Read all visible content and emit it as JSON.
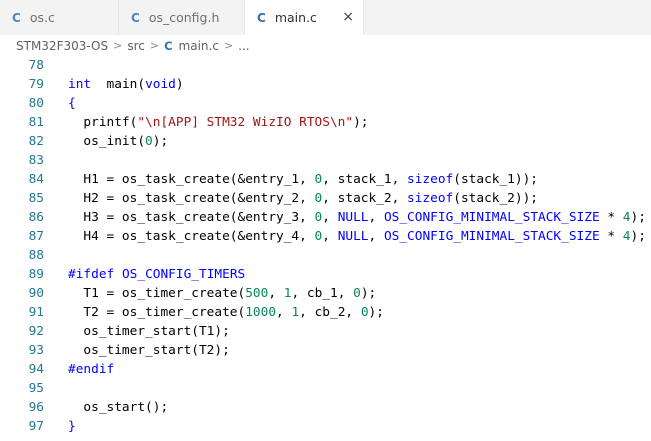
{
  "tabs": [
    {
      "icon": "C",
      "label": "os.c"
    },
    {
      "icon": "C",
      "label": "os_config.h"
    },
    {
      "icon": "C",
      "label": "main.c",
      "close": "×"
    }
  ],
  "breadcrumb": {
    "project": "STM32F303-OS",
    "folder": "src",
    "file_icon": "C",
    "file": "main.c",
    "more": "...",
    "separator": ">"
  },
  "colors": {
    "keyword": "#0000ff",
    "string": "#a31515",
    "number": "#098658",
    "line_number": "#237893",
    "c_icon": "#2f6fb3"
  },
  "code_lines": [
    {
      "n": "78",
      "tokens": []
    },
    {
      "n": "79",
      "tokens": [
        [
          "kw",
          "int"
        ],
        [
          "",
          "  main("
        ],
        [
          "kw",
          "void"
        ],
        [
          "",
          ")"
        ]
      ]
    },
    {
      "n": "80",
      "tokens": [
        [
          "kw",
          "{"
        ]
      ]
    },
    {
      "n": "81",
      "tokens": [
        [
          "",
          "  printf("
        ],
        [
          "str",
          "\"\\n[APP] STM32 WizIO RTOS\\n\""
        ],
        [
          "",
          ");"
        ]
      ]
    },
    {
      "n": "82",
      "tokens": [
        [
          "",
          "  os_init("
        ],
        [
          "num",
          "0"
        ],
        [
          "",
          ");"
        ]
      ]
    },
    {
      "n": "83",
      "tokens": []
    },
    {
      "n": "84",
      "tokens": [
        [
          "",
          "  H1 = os_task_create(&entry_1, "
        ],
        [
          "num",
          "0"
        ],
        [
          "",
          ", stack_1, "
        ],
        [
          "kw",
          "sizeof"
        ],
        [
          "",
          "(stack_1));"
        ]
      ]
    },
    {
      "n": "85",
      "tokens": [
        [
          "",
          "  H2 = os_task_create(&entry_2, "
        ],
        [
          "num",
          "0"
        ],
        [
          "",
          ", stack_2, "
        ],
        [
          "kw",
          "sizeof"
        ],
        [
          "",
          "(stack_2));"
        ]
      ]
    },
    {
      "n": "86",
      "tokens": [
        [
          "",
          "  H3 = os_task_create(&entry_3, "
        ],
        [
          "num",
          "0"
        ],
        [
          "",
          ", "
        ],
        [
          "mac",
          "NULL"
        ],
        [
          "",
          ", "
        ],
        [
          "mac",
          "OS_CONFIG_MINIMAL_STACK_SIZE"
        ],
        [
          "",
          " * "
        ],
        [
          "num",
          "4"
        ],
        [
          "",
          ");"
        ]
      ]
    },
    {
      "n": "87",
      "tokens": [
        [
          "",
          "  H4 = os_task_create(&entry_4, "
        ],
        [
          "num",
          "0"
        ],
        [
          "",
          ", "
        ],
        [
          "mac",
          "NULL"
        ],
        [
          "",
          ", "
        ],
        [
          "mac",
          "OS_CONFIG_MINIMAL_STACK_SIZE"
        ],
        [
          "",
          " * "
        ],
        [
          "num",
          "4"
        ],
        [
          "",
          ");"
        ]
      ]
    },
    {
      "n": "88",
      "tokens": []
    },
    {
      "n": "89",
      "tokens": [
        [
          "pp",
          "#ifdef"
        ],
        [
          "",
          " "
        ],
        [
          "mac",
          "OS_CONFIG_TIMERS"
        ]
      ]
    },
    {
      "n": "90",
      "tokens": [
        [
          "",
          "  T1 = os_timer_create("
        ],
        [
          "num",
          "500"
        ],
        [
          "",
          ", "
        ],
        [
          "num",
          "1"
        ],
        [
          "",
          ", cb_1, "
        ],
        [
          "num",
          "0"
        ],
        [
          "",
          ");"
        ]
      ]
    },
    {
      "n": "91",
      "tokens": [
        [
          "",
          "  T2 = os_timer_create("
        ],
        [
          "num",
          "1000"
        ],
        [
          "",
          ", "
        ],
        [
          "num",
          "1"
        ],
        [
          "",
          ", cb_2, "
        ],
        [
          "num",
          "0"
        ],
        [
          "",
          ");"
        ]
      ]
    },
    {
      "n": "92",
      "tokens": [
        [
          "",
          "  os_timer_start(T1);"
        ]
      ]
    },
    {
      "n": "93",
      "tokens": [
        [
          "",
          "  os_timer_start(T2);"
        ]
      ]
    },
    {
      "n": "94",
      "tokens": [
        [
          "pp",
          "#endif"
        ]
      ]
    },
    {
      "n": "95",
      "tokens": []
    },
    {
      "n": "96",
      "tokens": [
        [
          "",
          "  os_start();"
        ]
      ]
    },
    {
      "n": "97",
      "tokens": [
        [
          "kw",
          "}"
        ]
      ]
    }
  ]
}
